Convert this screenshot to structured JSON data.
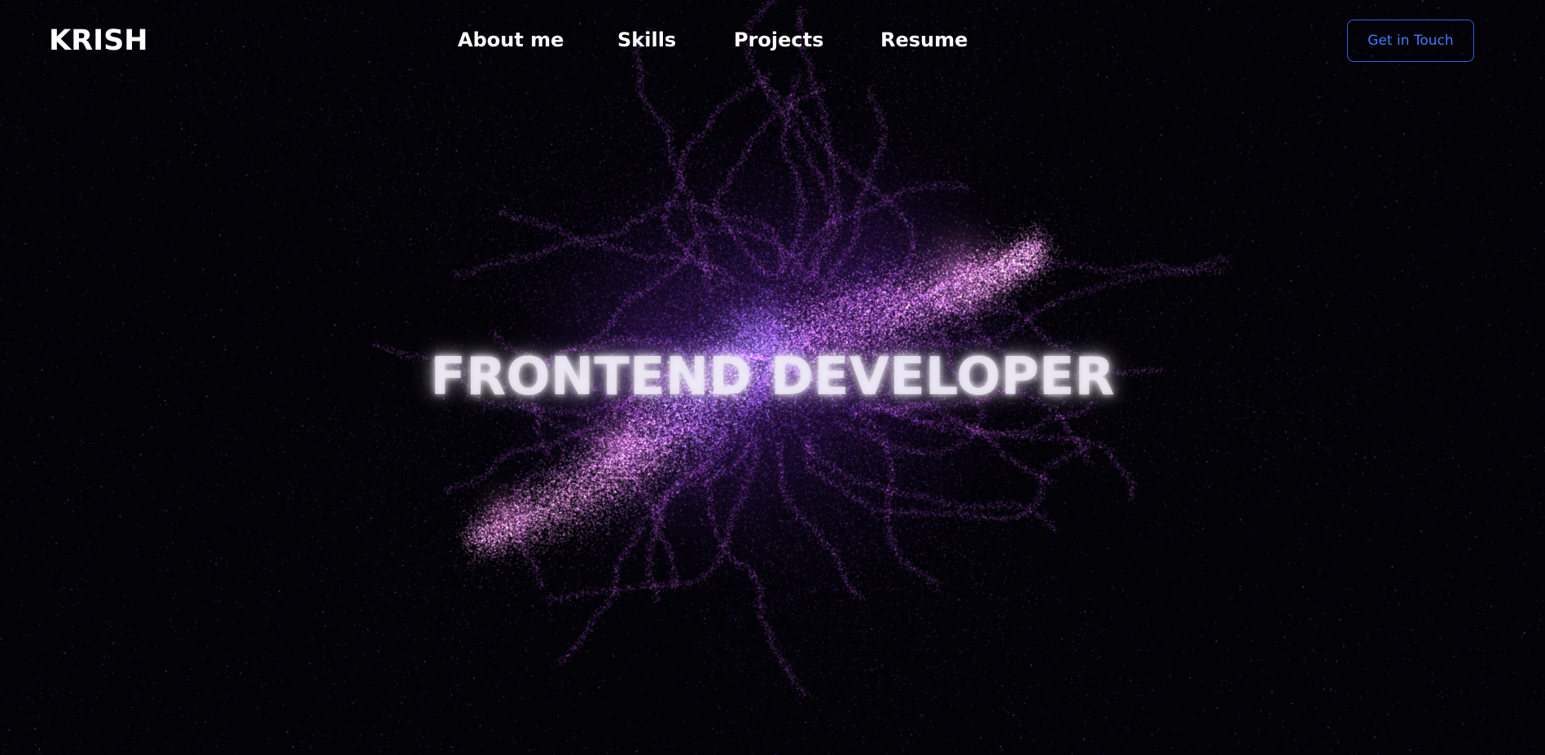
{
  "brand": {
    "logo_text": "KRISH"
  },
  "nav": {
    "items": [
      {
        "label": "About me"
      },
      {
        "label": "Skills"
      },
      {
        "label": "Projects"
      },
      {
        "label": "Resume"
      }
    ],
    "cta_label": "Get in Touch"
  },
  "hero": {
    "title": "FRONTEND DEVELOPER"
  },
  "colors": {
    "background": "#030207",
    "text": "#ffffff",
    "accent_blue": "#3f7bff",
    "nebula_pink": "#f58cf0",
    "nebula_purple": "#8a3fe0",
    "nebula_violet": "#b07cff"
  }
}
